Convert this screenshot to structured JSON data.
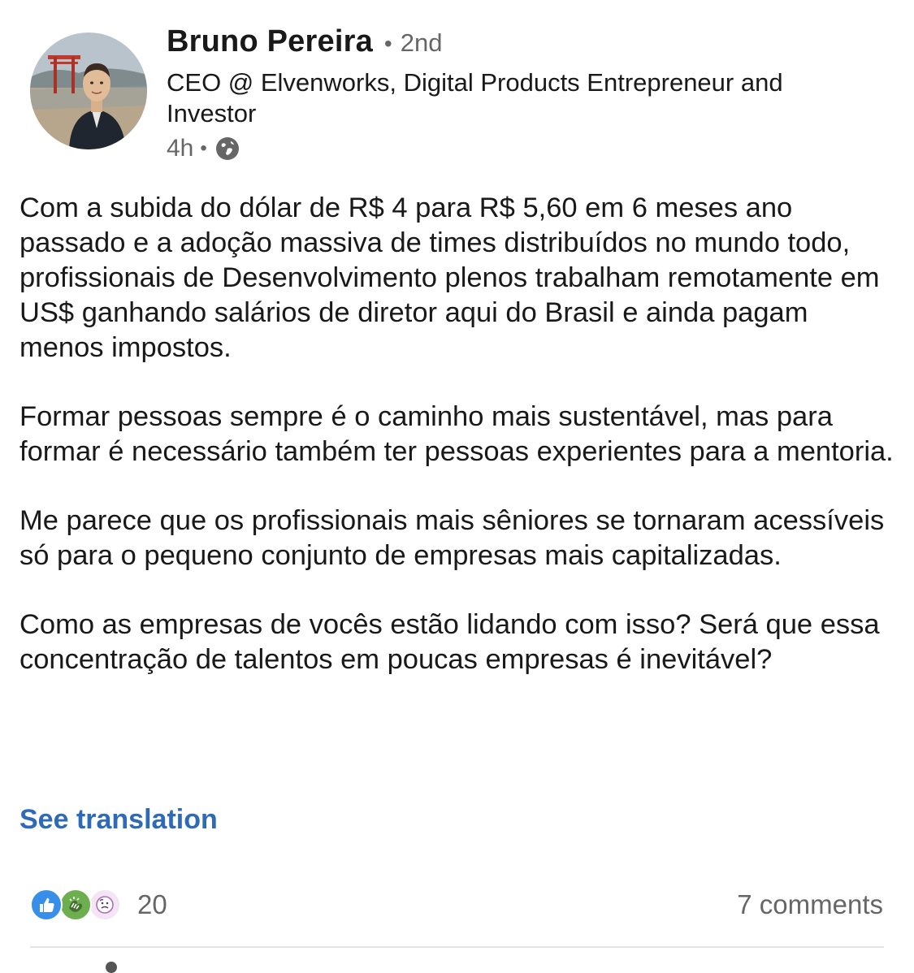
{
  "author": {
    "name": "Bruno Pereira",
    "connection_degree": "2nd",
    "separator": "•",
    "headline": "CEO @ Elvenworks, Digital Products Entrepreneur and Investor",
    "posted_ago": "4h",
    "visibility_icon": "globe-icon",
    "avatar_icon": "profile-photo"
  },
  "post": {
    "paragraphs": [
      "Com a subida do dólar de R$ 4 para R$ 5,60 em 6 meses ano passado e a adoção massiva de times distribuídos no mundo todo, profissionais de Desenvolvimento plenos trabalham remotamente em US$ ganhando salários de diretor aqui do Brasil e ainda pagam menos impostos.",
      "Formar pessoas sempre é o caminho mais sustentável, mas para formar é necessário também ter pessoas experientes para a mentoria.",
      "Me parece que os profissionais mais sêniores se tornaram acessíveis só para o pequeno conjunto de empresas mais capitalizadas.",
      "Como as empresas de vocês estão lidando com isso? Será que essa concentração de talentos em poucas empresas é inevitável?"
    ],
    "see_translation": "See translation"
  },
  "social": {
    "reaction_icons": [
      "like-icon",
      "celebrate-icon",
      "curious-icon"
    ],
    "reaction_count": "20",
    "comments": "7 comments"
  },
  "colors": {
    "text": "#191919",
    "muted": "#666666",
    "link": "#2e6ab8",
    "like": "#378fe9",
    "celebrate": "#44712e",
    "curious": "#df704d"
  }
}
